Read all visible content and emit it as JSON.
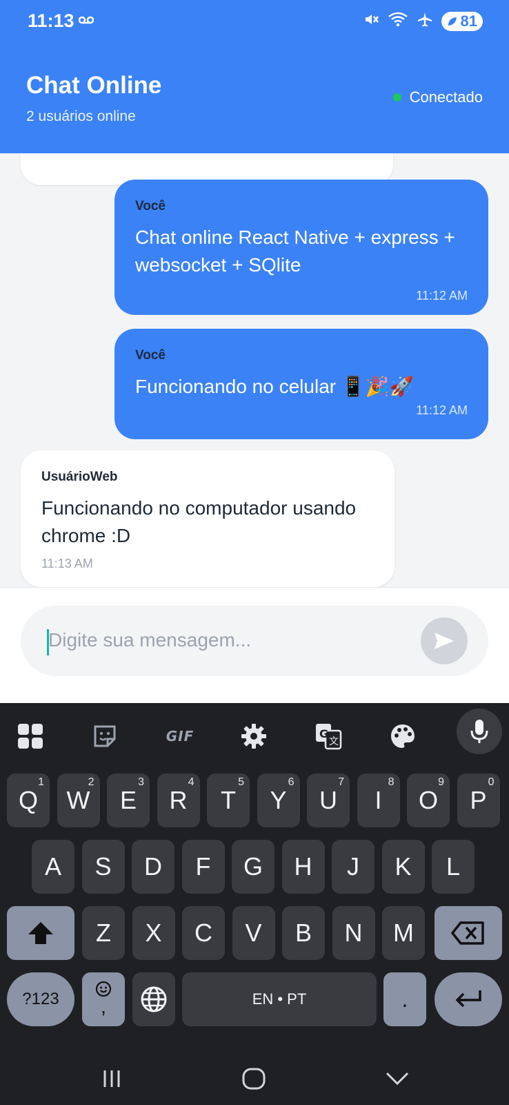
{
  "status_bar": {
    "time": "11:13",
    "battery": "81"
  },
  "header": {
    "title": "Chat Online",
    "subtitle": "2 usuários online",
    "connection_status": "Conectado"
  },
  "messages": [
    {
      "sender": "Você",
      "text": "Chat online React Native + express + websocket + SQlite",
      "time": "11:12 AM",
      "mine": true
    },
    {
      "sender": "Você",
      "text": "Funcionando no celular 📱🎉🚀",
      "time": "11:12 AM",
      "mine": true
    },
    {
      "sender": "UsuárioWeb",
      "text": "Funcionando no computador usando chrome :D",
      "time": "11:13 AM",
      "mine": false
    }
  ],
  "input": {
    "placeholder": "Digite sua mensagem..."
  },
  "keyboard": {
    "gif_label": "GIF",
    "row1": [
      {
        "k": "Q",
        "h": "1"
      },
      {
        "k": "W",
        "h": "2"
      },
      {
        "k": "E",
        "h": "3"
      },
      {
        "k": "R",
        "h": "4"
      },
      {
        "k": "T",
        "h": "5"
      },
      {
        "k": "Y",
        "h": "6"
      },
      {
        "k": "U",
        "h": "7"
      },
      {
        "k": "I",
        "h": "8"
      },
      {
        "k": "O",
        "h": "9"
      },
      {
        "k": "P",
        "h": "0"
      }
    ],
    "row2": [
      "A",
      "S",
      "D",
      "F",
      "G",
      "H",
      "J",
      "K",
      "L"
    ],
    "row3": [
      "Z",
      "X",
      "C",
      "V",
      "B",
      "N",
      "M"
    ],
    "symbols_label": "?123",
    "comma_label": ",",
    "space_label": "EN • PT",
    "period_label": "."
  },
  "colors": {
    "accent": "#3B82F6",
    "online": "#22C55E",
    "keyboard_bg": "#1F2024"
  }
}
